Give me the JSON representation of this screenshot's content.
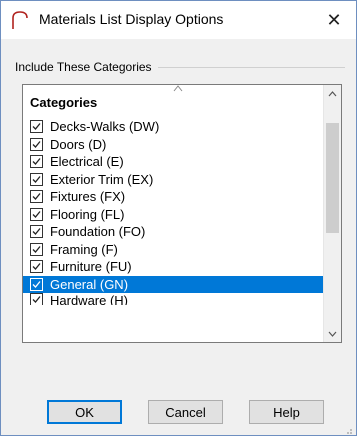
{
  "window": {
    "title": "Materials List Display Options",
    "close_glyph": "✕"
  },
  "group": {
    "label": "Include These Categories"
  },
  "list": {
    "header": "Categories",
    "items": [
      {
        "label": "Decks-Walks (DW)",
        "checked": true
      },
      {
        "label": "Doors (D)",
        "checked": true
      },
      {
        "label": "Electrical (E)",
        "checked": true
      },
      {
        "label": "Exterior Trim (EX)",
        "checked": true
      },
      {
        "label": "Fixtures (FX)",
        "checked": true
      },
      {
        "label": "Flooring (FL)",
        "checked": true
      },
      {
        "label": "Foundation (FO)",
        "checked": true
      },
      {
        "label": "Framing (F)",
        "checked": true
      },
      {
        "label": "Furniture (FU)",
        "checked": true
      },
      {
        "label": "General (GN)",
        "checked": true,
        "selected": true
      },
      {
        "label": "Hardware (H)",
        "checked": true,
        "partial": true
      }
    ]
  },
  "buttons": {
    "ok": "OK",
    "cancel": "Cancel",
    "help": "Help"
  },
  "colors": {
    "selection": "#0078d7",
    "app_icon": "#b0221e"
  }
}
